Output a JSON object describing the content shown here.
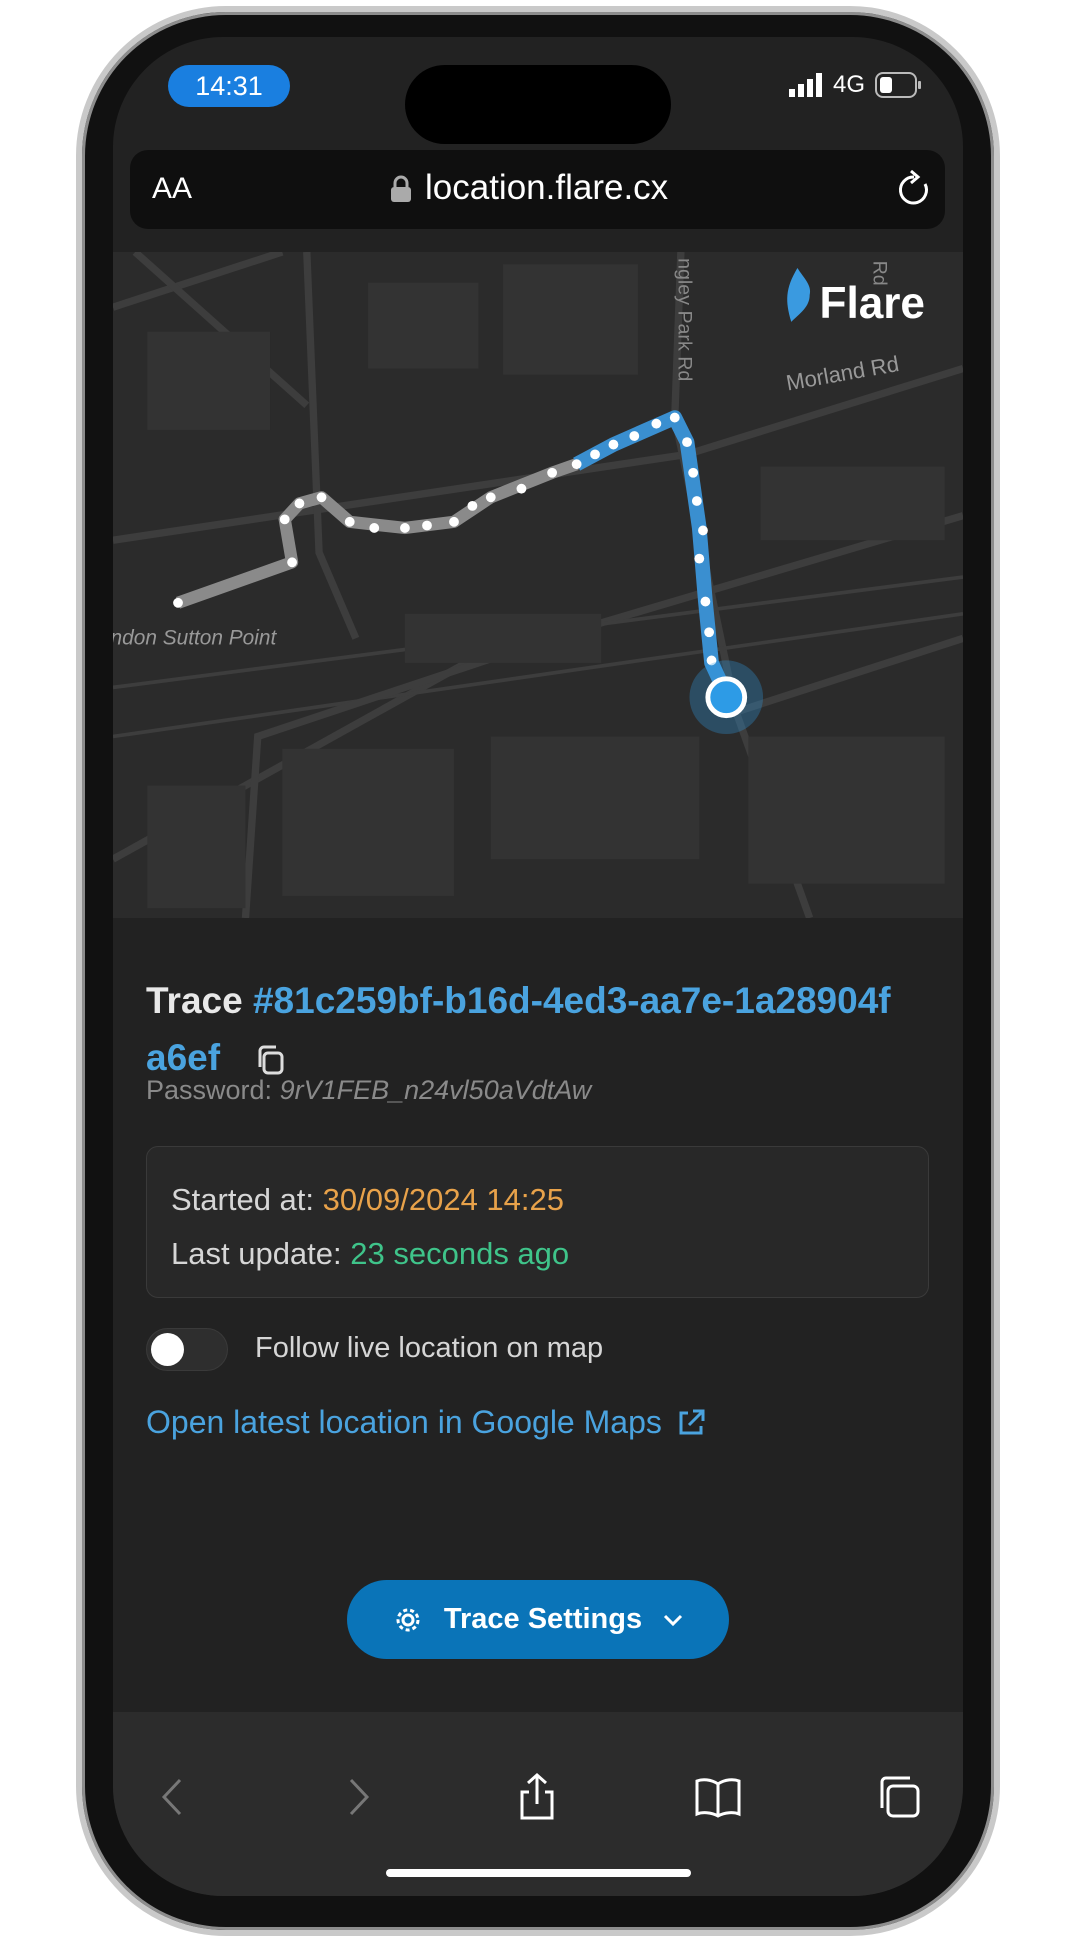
{
  "status_bar": {
    "time": "14:31",
    "network": "4G",
    "battery_level": 0.35,
    "icons": [
      "signal-icon",
      "battery-icon"
    ]
  },
  "browser": {
    "text_size_label": "AA",
    "url": "location.flare.cx",
    "icons": [
      "lock-icon",
      "reload-icon"
    ]
  },
  "map": {
    "brand": "Flare",
    "labels": {
      "street1": "ngley Park Rd",
      "street2": "Morland Rd",
      "street3": "Rd",
      "place": "ndon Sutton Point"
    },
    "colors": {
      "trace_past": "#8a8a8a",
      "trace_recent": "#3a8fd0",
      "current_location": "#2d9be6"
    }
  },
  "trace": {
    "prefix": "Trace",
    "id": "#81c259bf-b16d-4ed3-aa7e-1a28904fa6ef",
    "password_label": "Password:",
    "password": "9rV1FEB_n24vl50aVdtAw",
    "started_label": "Started at:",
    "started_value": "30/09/2024 14:25",
    "update_label": "Last update:",
    "update_value": "23 seconds ago",
    "follow_label": "Follow live location on map",
    "follow_enabled": false,
    "gmaps_link": "Open latest location in Google Maps",
    "settings_button": "Trace Settings"
  },
  "colors": {
    "accent": "#4aa3df",
    "started": "#e8a24a",
    "updated": "#3fc48a",
    "button": "#0a74b8"
  },
  "toolbar": {
    "icons": [
      "back-icon",
      "forward-icon",
      "share-icon",
      "bookmarks-icon",
      "tabs-icon"
    ]
  }
}
